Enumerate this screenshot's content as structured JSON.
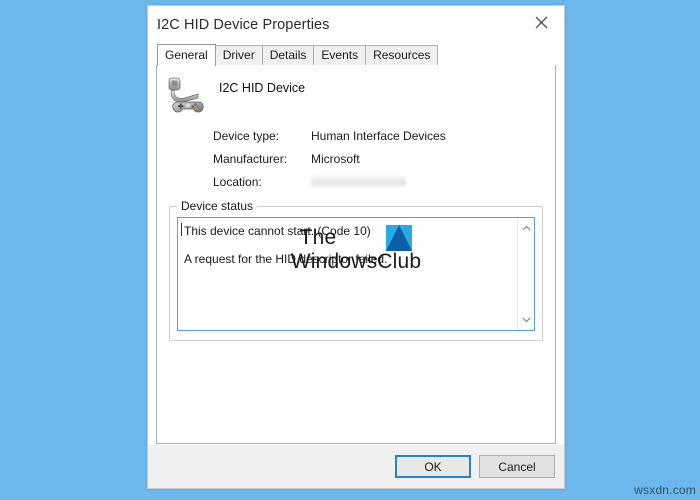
{
  "desktop": {
    "background_color": "#6cb8ec",
    "corner_watermark": "wsxdn.com"
  },
  "dialog": {
    "title": "I2C HID Device Properties",
    "close_icon": "close-icon",
    "tabs": [
      {
        "label": "General",
        "active": true
      },
      {
        "label": "Driver",
        "active": false
      },
      {
        "label": "Details",
        "active": false
      },
      {
        "label": "Events",
        "active": false
      },
      {
        "label": "Resources",
        "active": false
      }
    ],
    "general": {
      "device_icon": "hid-gamepad-device-icon",
      "device_name": "I2C HID Device",
      "properties": [
        {
          "label": "Device type:",
          "value": "Human Interface Devices",
          "redacted": false
        },
        {
          "label": "Manufacturer:",
          "value": "Microsoft",
          "redacted": false
        },
        {
          "label": "Location:",
          "value": "",
          "redacted": true
        }
      ],
      "device_status": {
        "legend": "Device status",
        "lines": [
          "This device cannot start. (Code 10)",
          "A request for the HID descriptor failed."
        ],
        "scroll_up_icon": "chevron-up-icon",
        "scroll_down_icon": "chevron-down-icon",
        "focus_border_color": "#5aa0d8"
      },
      "watermark": {
        "line1": "The",
        "line2": "WindowsClub",
        "logo_color": "#29abe2",
        "logo_accent_color": "#0b5fa5"
      }
    },
    "buttons": [
      {
        "label": "OK",
        "default": true
      },
      {
        "label": "Cancel",
        "default": false
      }
    ]
  }
}
